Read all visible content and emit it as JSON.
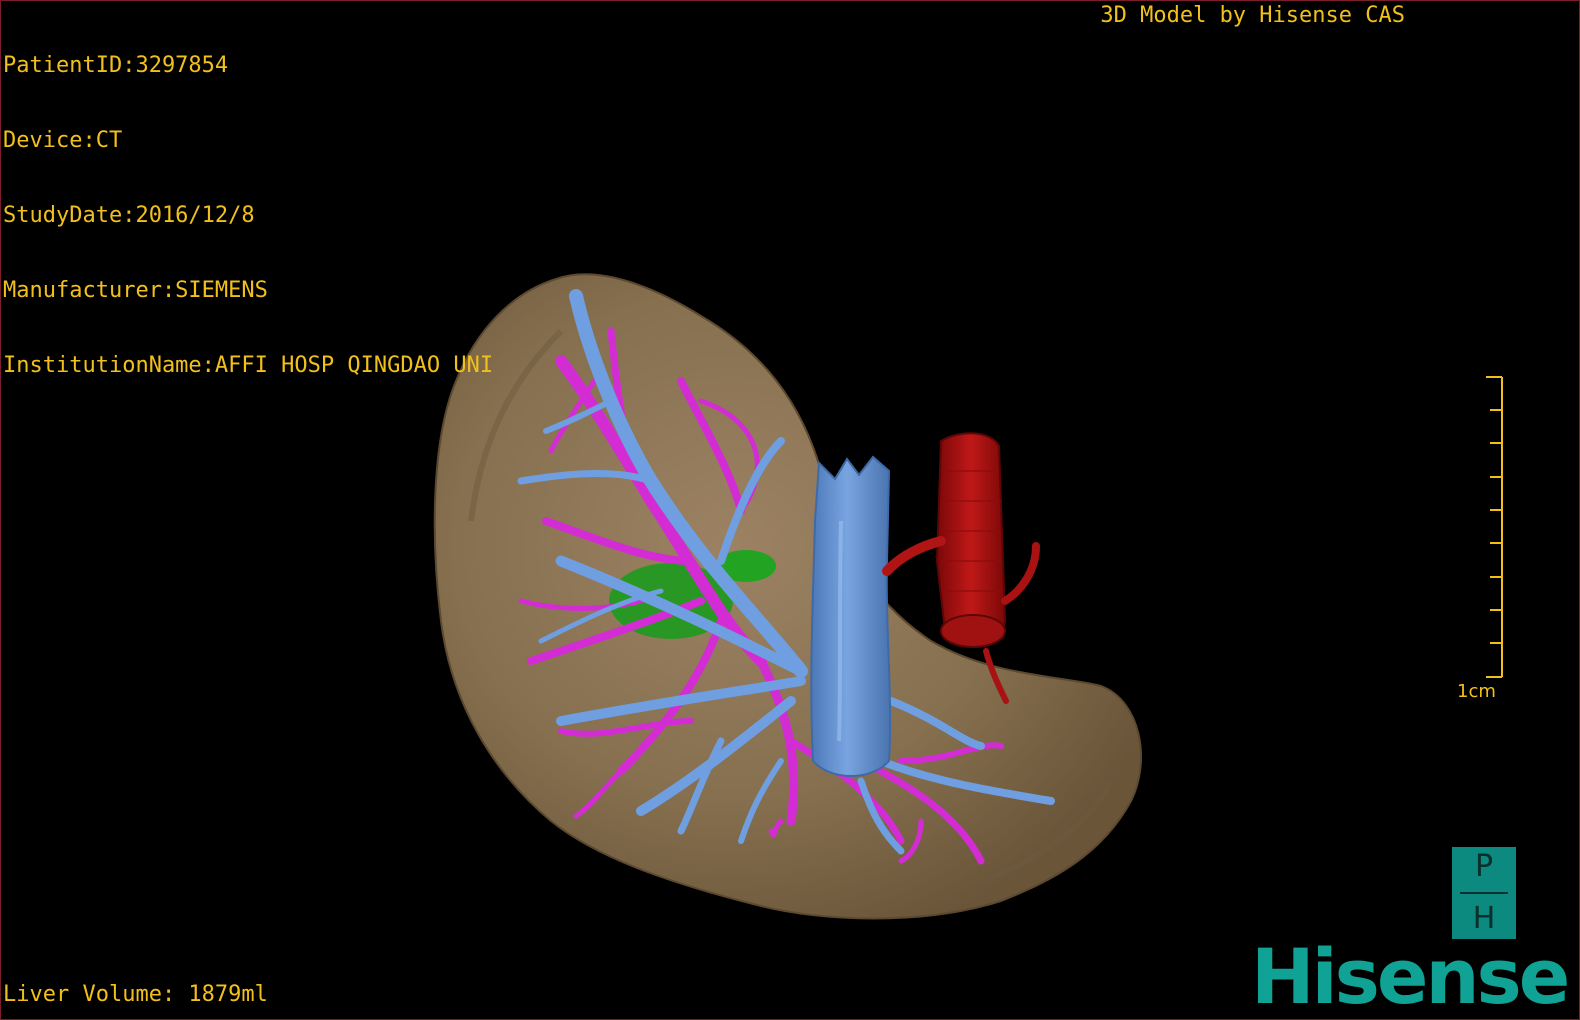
{
  "overlay": {
    "patient_id": "PatientID:3297854",
    "device": "Device:CT",
    "study_date": "StudyDate:2016/12/8",
    "manufacturer": "Manufacturer:SIEMENS",
    "institution": "InstitutionName:AFFI HOSP QINGDAO UNI",
    "credit": "3D Model by Hisense CAS",
    "liver_volume": "Liver Volume: 1879ml"
  },
  "scale_bar": {
    "label": "1cm"
  },
  "logo": {
    "badge_top": "P",
    "badge_bottom": "H",
    "brand": "Hisense"
  },
  "colors": {
    "overlay_text": "#f2c01c",
    "liver": "#8a7152",
    "portal_vein": "#d629d6",
    "hepatic_vein": "#6f9fe0",
    "inferior_vena_cava": "#5a89cf",
    "aorta": "#b01010",
    "lesion": "#1fa01f",
    "brand": "#10a294"
  }
}
